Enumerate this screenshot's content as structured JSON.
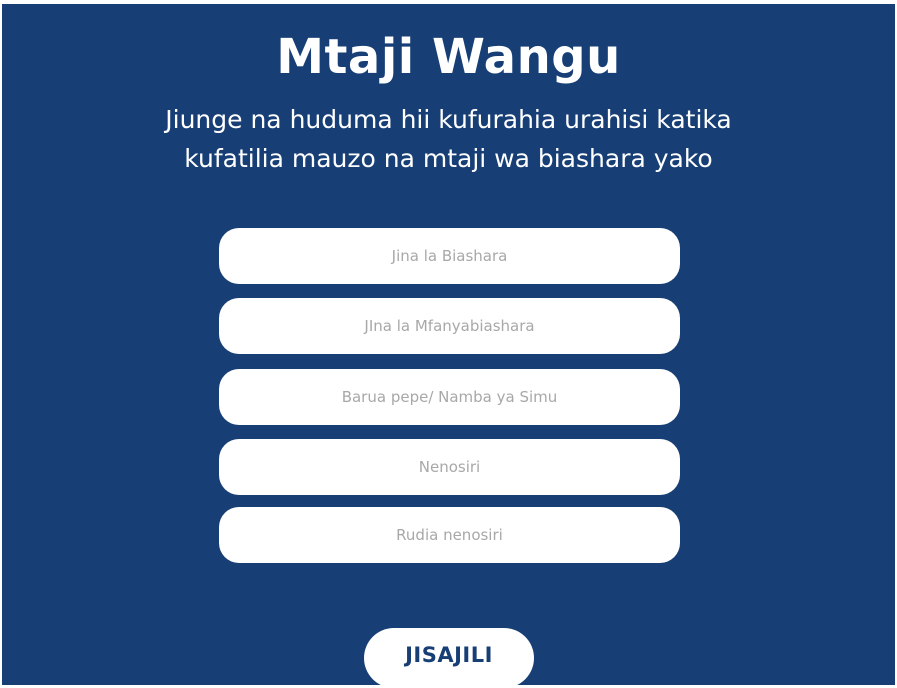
{
  "header": {
    "title": "Mtaji Wangu",
    "subtitle": "Jiunge na huduma hii kufurahia urahisi katika kufatilia mauzo na mtaji wa biashara yako"
  },
  "form": {
    "fields": [
      {
        "placeholder": "Jina la Biashara",
        "value": ""
      },
      {
        "placeholder": "JIna la Mfanyabiashara",
        "value": ""
      },
      {
        "placeholder": "Barua pepe/ Namba ya Simu",
        "value": ""
      },
      {
        "placeholder": "Nenosiri",
        "value": ""
      },
      {
        "placeholder": "Rudia nenosiri",
        "value": ""
      }
    ],
    "submit_label": "JISAJILI"
  },
  "colors": {
    "background": "#173f76",
    "field": "#ffffff",
    "text_light": "#ffffff",
    "placeholder": "#a8a8a8"
  }
}
